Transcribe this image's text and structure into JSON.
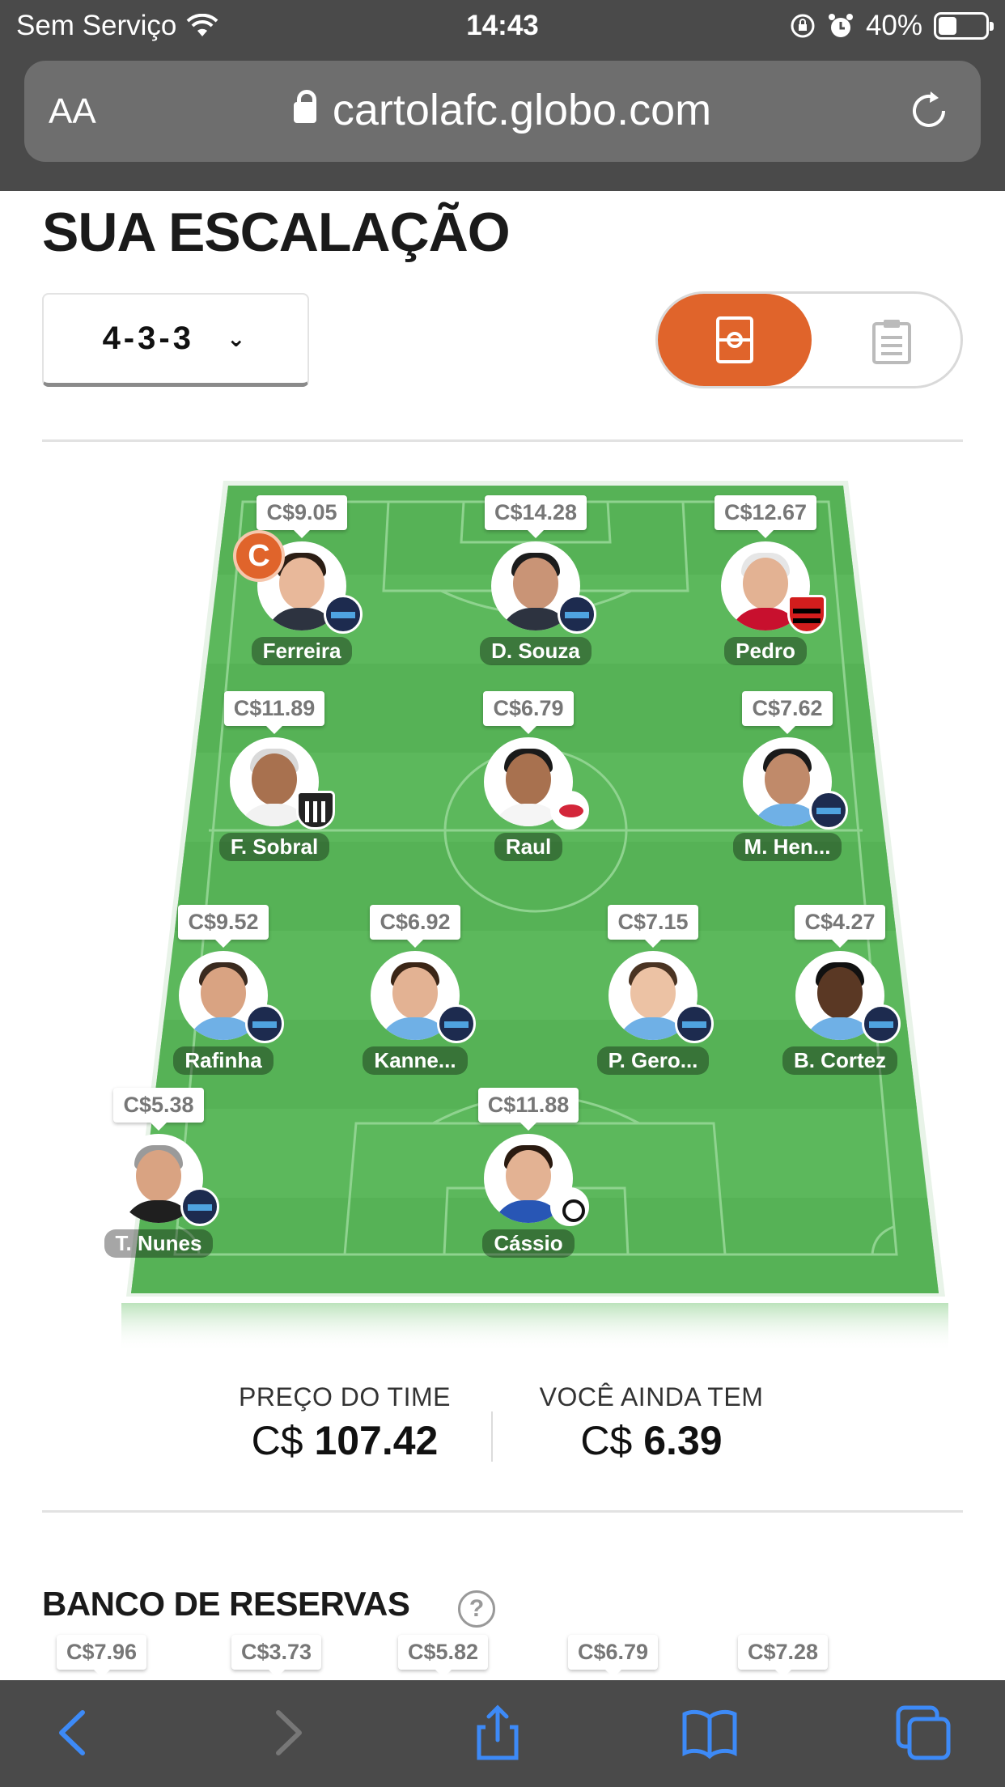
{
  "status_bar": {
    "carrier": "Sem Serviço",
    "time": "14:43",
    "battery": "40%",
    "battery_level": 0.4
  },
  "browser": {
    "font_control": "AA",
    "url": "cartolafc.globo.com"
  },
  "page": {
    "title": "SUA ESCALAÇÃO",
    "formation": "4-3-3",
    "view_toggle": {
      "active": "field-view",
      "inactive": "list-view"
    }
  },
  "lineup": [
    {
      "price": "C$9.05",
      "name": "Ferreira",
      "club": "gremio",
      "captain": true,
      "captain_label": "C"
    },
    {
      "price": "C$14.28",
      "name": "D. Souza",
      "club": "gremio"
    },
    {
      "price": "C$12.67",
      "name": "Pedro",
      "club": "flamengo"
    },
    {
      "price": "C$11.89",
      "name": "F. Sobral",
      "club": "ceara"
    },
    {
      "price": "C$6.79",
      "name": "Raul",
      "club": "red-bull-bragantino"
    },
    {
      "price": "C$7.62",
      "name": "M. Hen...",
      "club": "gremio"
    },
    {
      "price": "C$9.52",
      "name": "Rafinha",
      "club": "gremio"
    },
    {
      "price": "C$6.92",
      "name": "Kanne...",
      "club": "gremio"
    },
    {
      "price": "C$7.15",
      "name": "P. Gero...",
      "club": "gremio"
    },
    {
      "price": "C$4.27",
      "name": "B. Cortez",
      "club": "gremio"
    },
    {
      "price": "C$5.38",
      "name": "T. Nunes",
      "club": "gremio"
    },
    {
      "price": "C$11.88",
      "name": "Cássio",
      "club": "corinthians"
    }
  ],
  "totals": {
    "team_price_label": "PREÇO DO TIME",
    "team_price_currency": "C$",
    "team_price_value": "107.42",
    "remaining_label": "VOCÊ AINDA TEM",
    "remaining_currency": "C$",
    "remaining_value": "6.39"
  },
  "bench": {
    "title": "BANCO DE RESERVAS",
    "help": "?",
    "prices": [
      "C$7.96",
      "C$3.73",
      "C$5.82",
      "C$6.79",
      "C$7.28"
    ]
  },
  "colors": {
    "accent": "#e0642b",
    "field_green": "#5cb85c",
    "chrome": "#4a4a4a",
    "safari_blue": "#3d8af7"
  }
}
